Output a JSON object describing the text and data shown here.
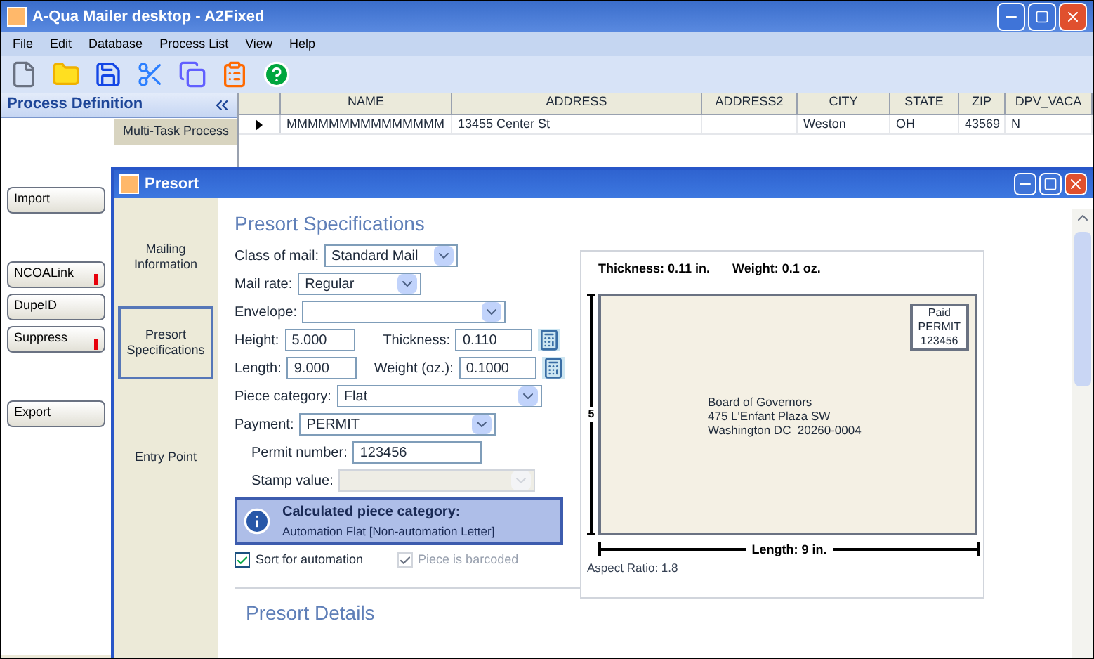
{
  "window": {
    "title": "A-Qua Mailer desktop - A2Fixed"
  },
  "menu": [
    "File",
    "Edit",
    "Database",
    "Process List",
    "View",
    "Help"
  ],
  "toolbar": [
    {
      "kind": "new"
    },
    {
      "kind": "open"
    },
    {
      "kind": "save"
    },
    {
      "kind": "cut"
    },
    {
      "kind": "copy"
    },
    {
      "kind": "paste"
    },
    {
      "kind": "help"
    }
  ],
  "process_panel": {
    "title": "Process Definition",
    "tab": "Multi-Task Process",
    "buttons": [
      {
        "label": "Import",
        "warning": false
      },
      {
        "label": "NCOALink",
        "warning": true
      },
      {
        "label": "DupeID",
        "warning": false
      },
      {
        "label": "Suppress",
        "warning": true
      },
      {
        "label": "Export",
        "warning": false
      }
    ]
  },
  "table": {
    "columns": [
      "NAME",
      "ADDRESS",
      "ADDRESS2",
      "CITY",
      "STATE",
      "ZIP",
      "DPV_VACA"
    ],
    "rows": [
      {
        "current": true,
        "cells": [
          "MMMMMMMMMMMMMMM",
          "13455 Center St",
          "",
          "Weston",
          "OH",
          "43569",
          "N"
        ]
      }
    ]
  },
  "dialog": {
    "title": "Presort",
    "nav": [
      {
        "label": "Mailing Information",
        "selected": false
      },
      {
        "label": "Presort Specifications",
        "selected": true
      },
      {
        "label": "Entry Point",
        "selected": false
      }
    ],
    "heading": "Presort Specifications",
    "class_of_mail": {
      "label": "Class of mail:",
      "value": "Standard Mail"
    },
    "mail_rate": {
      "label": "Mail rate:",
      "value": "Regular"
    },
    "envelope": {
      "label": "Envelope:"
    },
    "height": {
      "label": "Height:",
      "value": "5.000"
    },
    "thickness": {
      "label": "Thickness:",
      "value": "0.110"
    },
    "length": {
      "label": "Length:",
      "value": "9.000"
    },
    "weight": {
      "label": "Weight (oz.):",
      "value": "0.1000"
    },
    "piece_category": {
      "label": "Piece category:",
      "value": "Flat"
    },
    "payment": {
      "label": "Payment:",
      "value": "PERMIT"
    },
    "permit_number": {
      "label": "Permit number:",
      "value": "123456"
    },
    "stamp_value": {
      "label": "Stamp value:",
      "disabled": true
    },
    "notice": {
      "title": "Calculated piece category:",
      "text": "Automation Flat  [Non-automation Letter]"
    },
    "checkboxes": [
      {
        "label": "Sort for automation",
        "checked": true,
        "disabled": false
      },
      {
        "label": "Piece is barcoded",
        "checked": true,
        "disabled": true
      }
    ],
    "details_heading": "Presort Details",
    "preview": {
      "thickness": "Thickness: 0.11 in.",
      "weight": "Weight: 0.1 oz.",
      "height_mark": "5",
      "indicia": [
        "Paid",
        "PERMIT",
        "123456"
      ],
      "address": [
        "Board of Governors",
        "475 L'Enfant Plaza SW",
        "Washington DC  20260-0004"
      ],
      "length": "Length: 9 in.",
      "aspect_ratio": "Aspect Ratio: 1.8"
    }
  }
}
